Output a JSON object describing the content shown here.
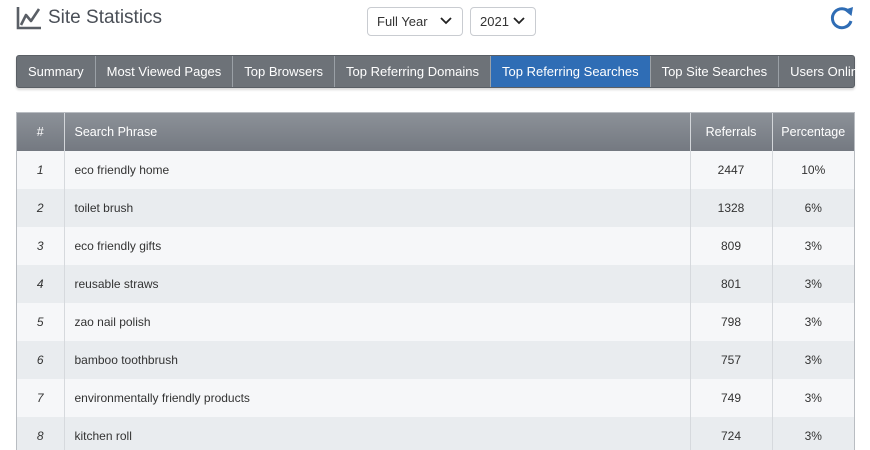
{
  "header": {
    "title": "Site Statistics",
    "logo_icon": "line-chart-icon",
    "refresh_icon": "refresh-icon"
  },
  "filters": {
    "period": "Full Year",
    "year": "2021"
  },
  "tabs": [
    {
      "label": "Summary",
      "active": false
    },
    {
      "label": "Most Viewed Pages",
      "active": false
    },
    {
      "label": "Top Browsers",
      "active": false
    },
    {
      "label": "Top Referring Domains",
      "active": false
    },
    {
      "label": "Top Referring Searches",
      "active": true
    },
    {
      "label": "Top Site Searches",
      "active": false
    },
    {
      "label": "Users Online Now",
      "active": false
    }
  ],
  "table": {
    "columns": [
      "#",
      "Search Phrase",
      "Referrals",
      "Percentage"
    ],
    "rows": [
      {
        "num": "1",
        "phrase": "eco friendly home",
        "referrals": "2447",
        "percentage": "10%"
      },
      {
        "num": "2",
        "phrase": "toilet brush",
        "referrals": "1328",
        "percentage": "6%"
      },
      {
        "num": "3",
        "phrase": "eco friendly gifts",
        "referrals": "809",
        "percentage": "3%"
      },
      {
        "num": "4",
        "phrase": "reusable straws",
        "referrals": "801",
        "percentage": "3%"
      },
      {
        "num": "5",
        "phrase": "zao nail polish",
        "referrals": "798",
        "percentage": "3%"
      },
      {
        "num": "6",
        "phrase": "bamboo toothbrush",
        "referrals": "757",
        "percentage": "3%"
      },
      {
        "num": "7",
        "phrase": "environmentally friendly products",
        "referrals": "749",
        "percentage": "3%"
      },
      {
        "num": "8",
        "phrase": "kitchen roll",
        "referrals": "724",
        "percentage": "3%"
      }
    ]
  },
  "colors": {
    "active_tab": "#2f6db5",
    "tabbar": "#6d7278",
    "refresh": "#2f6db5"
  }
}
